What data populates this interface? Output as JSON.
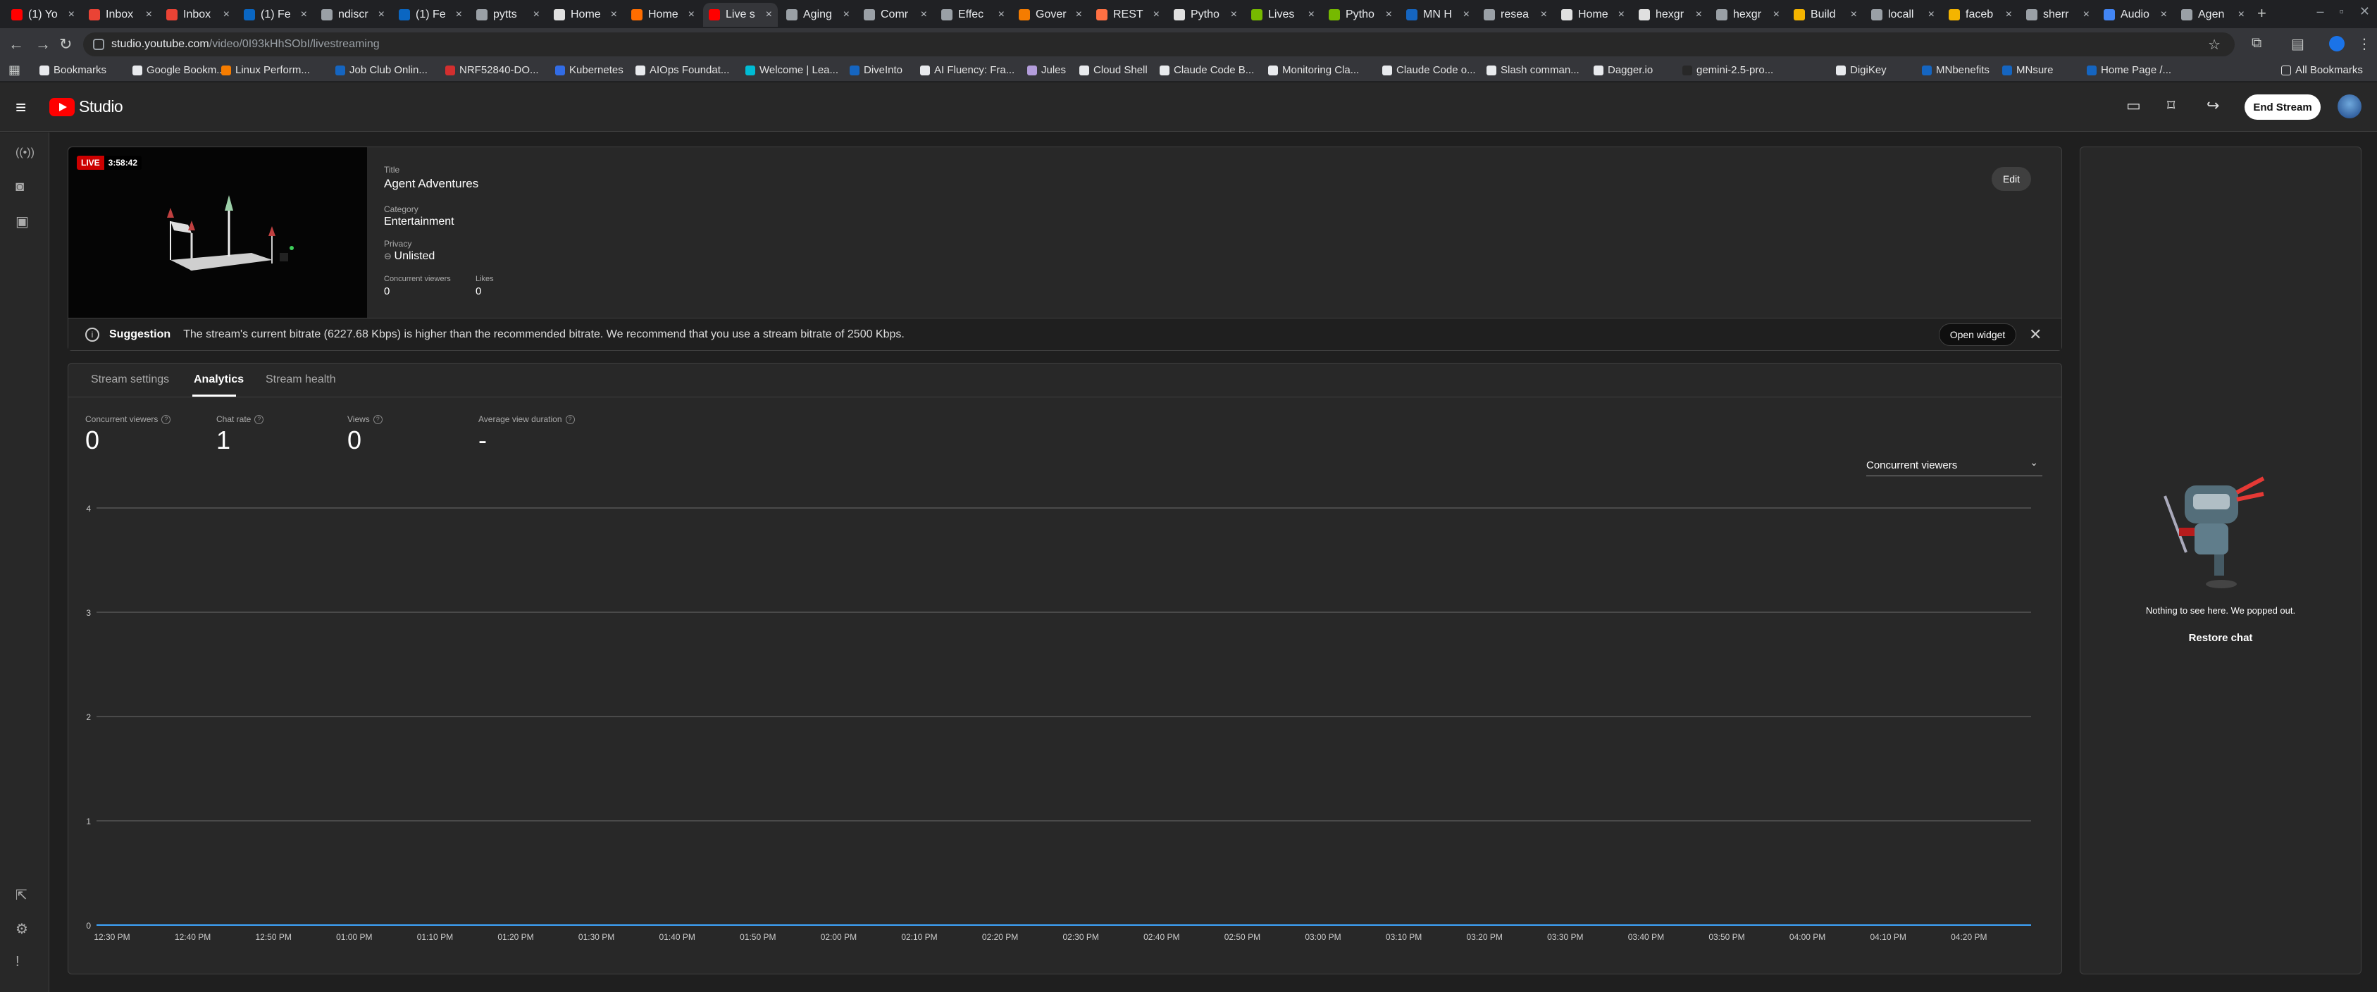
{
  "browser": {
    "tabs": [
      {
        "label": "(1) Yo",
        "color": "#ff0000"
      },
      {
        "label": "Inbox",
        "color": "#ea4335"
      },
      {
        "label": "Inbox",
        "color": "#ea4335"
      },
      {
        "label": "(1) Fe",
        "color": "#0a66c2"
      },
      {
        "label": "ndiscr",
        "color": "#9aa0a6"
      },
      {
        "label": "(1) Fe",
        "color": "#0a66c2"
      },
      {
        "label": "pytts",
        "color": "#9aa0a6"
      },
      {
        "label": "Home",
        "color": "#e0e0e0"
      },
      {
        "label": "Home",
        "color": "#ff6d00"
      },
      {
        "label": "Live s",
        "color": "#ff0000"
      },
      {
        "label": "Aging",
        "color": "#9aa0a6"
      },
      {
        "label": "Comr",
        "color": "#9aa0a6"
      },
      {
        "label": "Effec",
        "color": "#9aa0a6"
      },
      {
        "label": "Gover",
        "color": "#f57c00"
      },
      {
        "label": "REST",
        "color": "#ff7043"
      },
      {
        "label": "Pytho",
        "color": "#e0e0e0"
      },
      {
        "label": "Lives",
        "color": "#76b900"
      },
      {
        "label": "Pytho",
        "color": "#76b900"
      },
      {
        "label": "MN H",
        "color": "#1565c0"
      },
      {
        "label": "resea",
        "color": "#9aa0a6"
      },
      {
        "label": "Home",
        "color": "#e0e0e0"
      },
      {
        "label": "hexgr",
        "color": "#e0e0e0"
      },
      {
        "label": "hexgr",
        "color": "#9aa0a6"
      },
      {
        "label": "Build",
        "color": "#f4b400"
      },
      {
        "label": "locall",
        "color": "#9aa0a6"
      },
      {
        "label": "faceb",
        "color": "#f4b400"
      },
      {
        "label": "sherr",
        "color": "#9aa0a6"
      },
      {
        "label": "Audio",
        "color": "#4285f4"
      },
      {
        "label": "Agen",
        "color": "#9aa0a6"
      }
    ],
    "active_tab_index": 9,
    "url_host": "studio.youtube.com",
    "url_path": "/video/0I93kHhSObI/livestreaming",
    "bookmarks": [
      {
        "label": "Bookmarks",
        "icon": "star-icon",
        "color": "#e8eaed"
      },
      {
        "label": "Google Bookm...",
        "icon": "globe-icon",
        "color": "#e8eaed"
      },
      {
        "label": "Linux Perform...",
        "icon": "chart-icon",
        "color": "#f57c00"
      },
      {
        "label": "Job Club Onlin...",
        "icon": "bookmark-icon",
        "color": "#1565c0"
      },
      {
        "label": "NRF52840-DO...",
        "icon": "bookmark-icon",
        "color": "#d32f2f"
      },
      {
        "label": "Kubernetes",
        "icon": "kubernetes-icon",
        "color": "#326ce5"
      },
      {
        "label": "AIOps Foundat...",
        "icon": "bookmark-icon",
        "color": "#e8eaed"
      },
      {
        "label": "Welcome | Lea...",
        "icon": "bookmark-icon",
        "color": "#00bcd4"
      },
      {
        "label": "DiveInto",
        "icon": "bookmark-icon",
        "color": "#1565c0"
      },
      {
        "label": "AI Fluency: Fra...",
        "icon": "anthropic-icon",
        "color": "#e8eaed"
      },
      {
        "label": "Jules",
        "icon": "bookmark-icon",
        "color": "#b39ddb"
      },
      {
        "label": "Cloud Shell",
        "icon": "terminal-icon",
        "color": "#e8eaed"
      },
      {
        "label": "Claude Code B...",
        "icon": "anthropic-icon",
        "color": "#e8eaed"
      },
      {
        "label": "Monitoring Cla...",
        "icon": "globe-icon",
        "color": "#e8eaed"
      },
      {
        "label": "Claude Code o...",
        "icon": "anthropic-icon",
        "color": "#e8eaed"
      },
      {
        "label": "Slash comman...",
        "icon": "anthropic-icon",
        "color": "#e8eaed"
      },
      {
        "label": "Dagger.io",
        "icon": "bookmark-icon",
        "color": "#e8eaed"
      },
      {
        "label": "gemini-2.5-pro...",
        "icon": "bookmark-icon",
        "color": "#282828"
      },
      {
        "label": "DigiKey",
        "icon": "bookmark-icon",
        "color": "#e8eaed"
      },
      {
        "label": "MNbenefits",
        "icon": "bookmark-icon",
        "color": "#1565c0"
      },
      {
        "label": "MNsure",
        "icon": "bookmark-icon",
        "color": "#1565c0"
      },
      {
        "label": "Home Page /...",
        "icon": "bookmark-icon",
        "color": "#1565c0"
      }
    ],
    "all_bookmarks": "All Bookmarks"
  },
  "studio": {
    "logo_text": "Studio",
    "end_stream": "End Stream",
    "stream": {
      "live_label": "LIVE",
      "duration": "3:58:42",
      "title_label": "Title",
      "title": "Agent Adventures",
      "category_label": "Category",
      "category": "Entertainment",
      "privacy_label": "Privacy",
      "privacy": "Unlisted",
      "concurrent_label": "Concurrent viewers",
      "concurrent": "0",
      "likes_label": "Likes",
      "likes": "0",
      "edit": "Edit"
    },
    "suggestion": {
      "title": "Suggestion",
      "text": "The stream's current bitrate (6227.68 Kbps) is higher than the recommended bitrate. We recommend that you use a stream bitrate of 2500 Kbps.",
      "open_widget": "Open widget"
    },
    "tabs": [
      "Stream settings",
      "Analytics",
      "Stream health"
    ],
    "active_tab": "Analytics",
    "kpis": [
      {
        "label": "Concurrent viewers",
        "value": "0"
      },
      {
        "label": "Chat rate",
        "value": "1"
      },
      {
        "label": "Views",
        "value": "0"
      },
      {
        "label": "Average view duration",
        "value": "-"
      }
    ],
    "metric_select": "Concurrent viewers",
    "chat": {
      "message": "Nothing to see here. We popped out.",
      "restore": "Restore chat"
    }
  },
  "chart_data": {
    "type": "line",
    "x": [
      "12:30 PM",
      "12:40 PM",
      "12:50 PM",
      "01:00 PM",
      "01:10 PM",
      "01:20 PM",
      "01:30 PM",
      "01:40 PM",
      "01:50 PM",
      "02:00 PM",
      "02:10 PM",
      "02:20 PM",
      "02:30 PM",
      "02:40 PM",
      "02:50 PM",
      "03:00 PM",
      "03:10 PM",
      "03:20 PM",
      "03:30 PM",
      "03:40 PM",
      "03:50 PM",
      "04:00 PM",
      "04:10 PM",
      "04:20 PM"
    ],
    "yticks": [
      0,
      1,
      2,
      3,
      4
    ],
    "ylim": [
      0,
      4
    ],
    "series": [
      {
        "values": [
          0,
          0,
          0,
          0,
          0,
          0,
          0,
          0,
          0,
          0,
          0,
          0,
          0,
          0,
          0,
          0,
          0,
          0,
          0,
          0,
          0,
          0,
          0,
          0
        ],
        "color": "#3ea6ff"
      }
    ],
    "grid": true
  }
}
